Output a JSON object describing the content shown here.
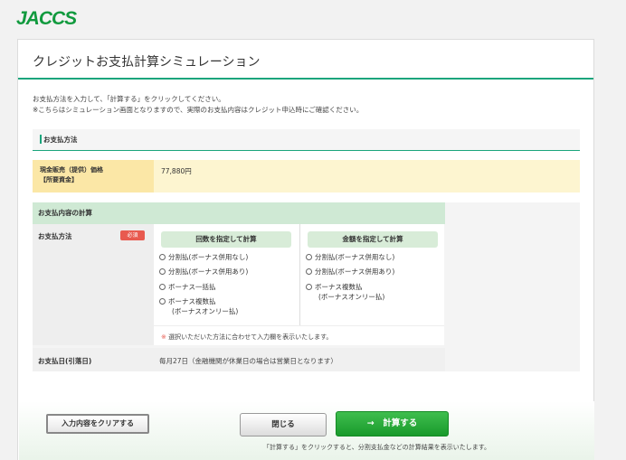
{
  "brand": {
    "logo": "JACCS",
    "color": "#119a3e"
  },
  "page": {
    "title": "クレジットお支払計算シミュレーション"
  },
  "intro": {
    "line1": "お支払方法を入力して、「計算する」をクリックしてください。",
    "line2": "※こちらはシミュレーション画面となりますので、実際のお支払内容はクレジット申込時にご確認ください。"
  },
  "section": {
    "title": "お支払方法"
  },
  "price": {
    "label_line1": "現金販売（提供）価格",
    "label_line2": "【所要資金】",
    "value": "77,880円"
  },
  "calc": {
    "header": "お支払内容の計算",
    "method_label": "お支払方法",
    "required_badge": "必須",
    "count_button": "回数を指定して計算",
    "amount_button": "金額を指定して計算",
    "count_options": [
      "分割払(ボーナス併用なし)",
      "分割払(ボーナス併用あり)",
      "ボーナス一括払",
      "ボーナス複数払",
      "(ボーナスオンリー払)"
    ],
    "amount_options": [
      "分割払(ボーナス併用なし)",
      "分割払(ボーナス併用あり)",
      "ボーナス複数払",
      "(ボーナスオンリー払)"
    ],
    "note_mark": "※",
    "note": "選択いただいた方法に合わせて入力欄を表示いたします。",
    "date_label": "お支払日(引落日)",
    "date_value": "毎月27日（金融機関が休業日の場合は営業日となります）"
  },
  "footer": {
    "clear_button": "入力内容をクリアする",
    "close_button": "閉じる",
    "calc_button": "→　計算する",
    "note": "「計算する」をクリックすると、分割支払金などの計算結果を表示いたします。"
  },
  "colors": {
    "accent": "#1aa57c",
    "primary_button": "#199a2c",
    "required": "#e85a4f"
  }
}
